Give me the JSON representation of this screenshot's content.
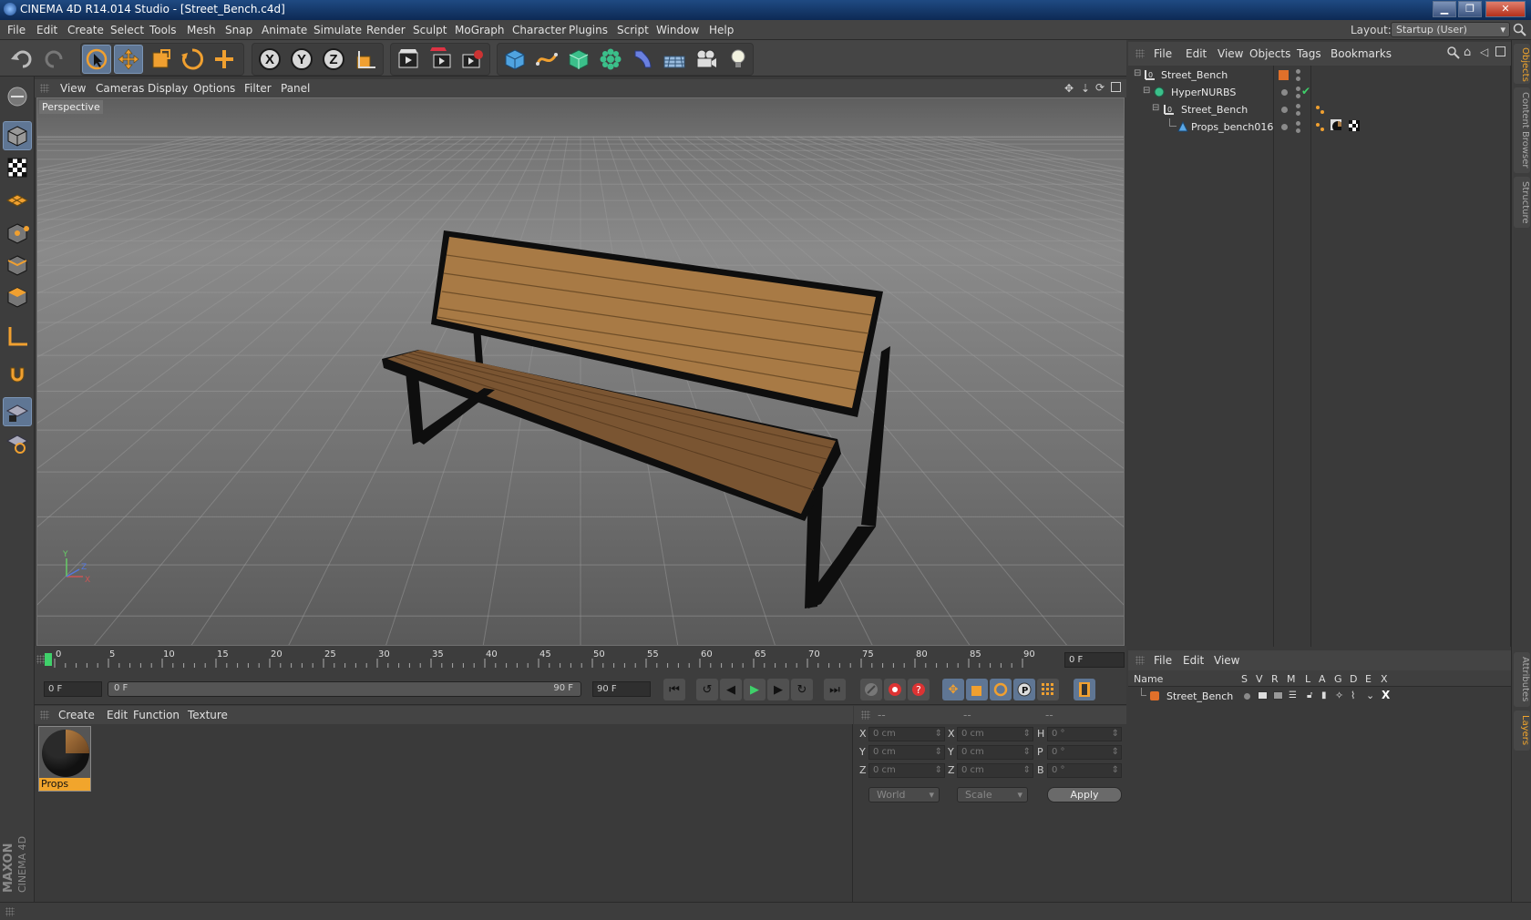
{
  "window": {
    "title": "CINEMA 4D R14.014 Studio - [Street_Bench.c4d]",
    "minimize": "▁",
    "maximize": "❐",
    "close": "✕"
  },
  "menubar": {
    "items": [
      "File",
      "Edit",
      "Create",
      "Select",
      "Tools",
      "Mesh",
      "Snap",
      "Animate",
      "Simulate",
      "Render",
      "Sculpt",
      "MoGraph",
      "Character",
      "Plugins",
      "Script",
      "Window",
      "Help"
    ],
    "layout_label": "Layout:",
    "layout_value": "Startup (User)"
  },
  "toolbar": {
    "axis_x": "X",
    "axis_y": "Y",
    "axis_z": "Z"
  },
  "viewport": {
    "menu": [
      "View",
      "Cameras",
      "Display",
      "Options",
      "Filter",
      "Panel"
    ],
    "label": "Perspective",
    "axis_y": "Y",
    "axis_x": "X",
    "axis_z": "Z",
    "grid_color": "#9a9a9a",
    "wood_color": "#a87a45",
    "frame_color": "#111111"
  },
  "timeline": {
    "ticks": [
      "0",
      "5",
      "10",
      "15",
      "20",
      "25",
      "30",
      "35",
      "40",
      "45",
      "50",
      "55",
      "60",
      "65",
      "70",
      "75",
      "80",
      "85",
      "90"
    ],
    "current_frame": "0 F"
  },
  "transport": {
    "start_field": "0 F",
    "slider_left": "0 F",
    "slider_right": "90 F",
    "end_field": "90 F"
  },
  "material_manager": {
    "menu": [
      "Create",
      "Edit",
      "Function",
      "Texture"
    ],
    "material_name": "Props"
  },
  "coordinates": {
    "header": [
      "--",
      "--",
      "--"
    ],
    "rows": [
      {
        "pos_label": "X",
        "pos_value": "0 cm",
        "size_label": "X",
        "size_value": "0 cm",
        "rot_label": "H",
        "rot_value": "0 °"
      },
      {
        "pos_label": "Y",
        "pos_value": "0 cm",
        "size_label": "Y",
        "size_value": "0 cm",
        "rot_label": "P",
        "rot_value": "0 °"
      },
      {
        "pos_label": "Z",
        "pos_value": "0 cm",
        "size_label": "Z",
        "size_value": "0 cm",
        "rot_label": "B",
        "rot_value": "0 °"
      }
    ],
    "mode_select": "World",
    "scale_select": "Scale",
    "apply": "Apply"
  },
  "object_manager": {
    "menu": [
      "File",
      "Edit",
      "View",
      "Objects",
      "Tags",
      "Bookmarks"
    ],
    "objects": [
      {
        "name": "Street_Bench"
      },
      {
        "name": "HyperNURBS"
      },
      {
        "name": "Street_Bench"
      },
      {
        "name": "Props_bench016"
      }
    ],
    "check": "✔"
  },
  "layer_manager": {
    "menu": [
      "File",
      "Edit",
      "View"
    ],
    "columns": [
      "Name",
      "S",
      "V",
      "R",
      "M",
      "L",
      "A",
      "G",
      "D",
      "E",
      "X"
    ],
    "layers": [
      {
        "name": "Street_Bench",
        "color": "#e0702a"
      }
    ]
  },
  "right_tabs": [
    "Objects",
    "Content Browser",
    "Structure",
    "Attributes",
    "Layers"
  ],
  "brand": {
    "maxon": "MAXON",
    "cinema": "CINEMA 4D"
  },
  "colors": {
    "accent": "#f1a52c",
    "selected": "#5f7694",
    "orange_icon": "#f0a030"
  }
}
